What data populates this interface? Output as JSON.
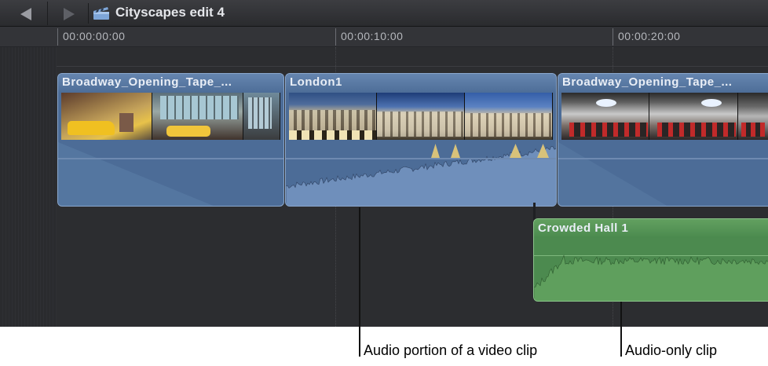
{
  "header": {
    "project_title": "Cityscapes edit 4",
    "back_icon": "back-arrow-icon",
    "forward_icon": "forward-arrow-icon",
    "project_icon": "clapperboard-icon"
  },
  "ruler": {
    "labels": [
      "00:00:00:00",
      "00:00:10:00",
      "00:00:20:00"
    ]
  },
  "clips": {
    "video": [
      {
        "name": "Broadway_Opening_Tape_...",
        "type": "video"
      },
      {
        "name": "London1",
        "type": "video"
      },
      {
        "name": "Broadway_Opening_Tape_...",
        "type": "video"
      }
    ],
    "audio": [
      {
        "name": "Crowded Hall 1",
        "type": "audio"
      }
    ]
  },
  "callouts": {
    "video_audio": "Audio portion of a video clip",
    "audio_only": "Audio-only clip"
  },
  "colors": {
    "video_clip": "#4c6c97",
    "audio_clip": "#4c8a4f",
    "background": "#2b2c2f"
  }
}
